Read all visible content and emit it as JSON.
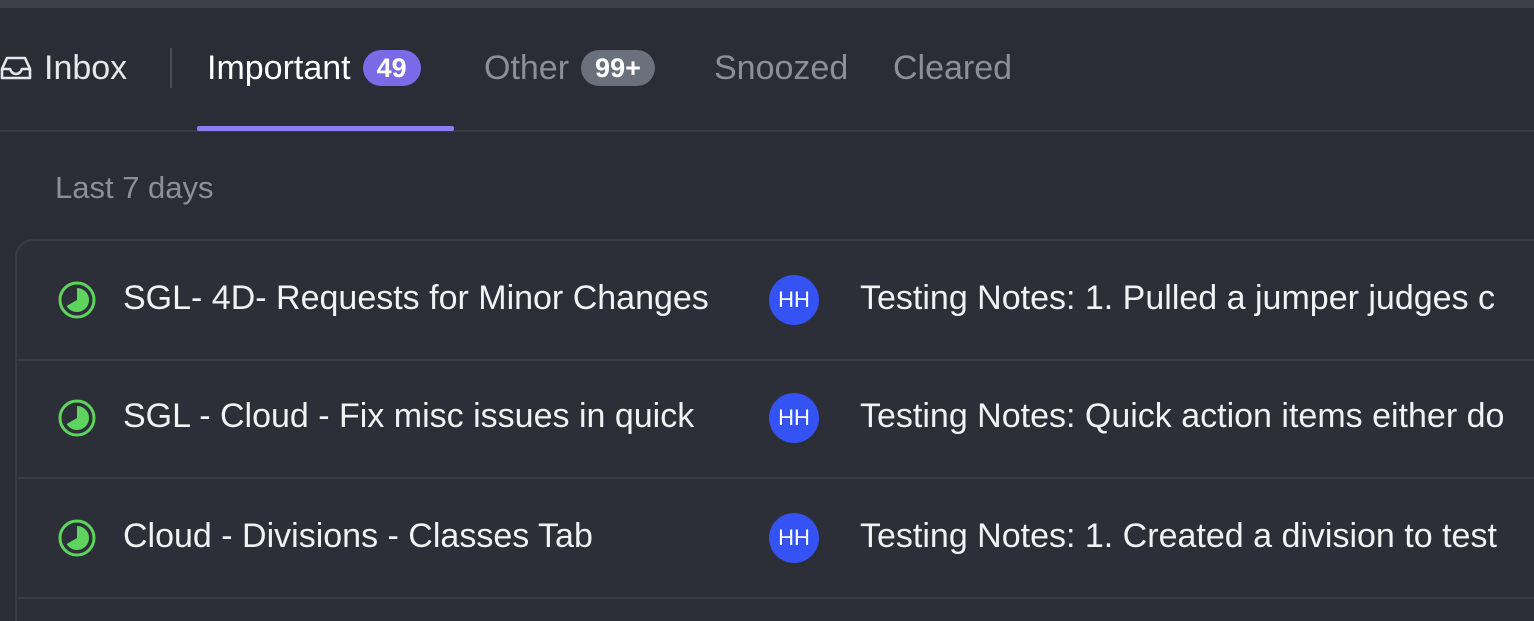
{
  "tabs": {
    "inbox": {
      "label": "Inbox",
      "icon": "inbox-icon"
    },
    "important": {
      "label": "Important",
      "badge": "49"
    },
    "other": {
      "label": "Other",
      "badge": "99+"
    },
    "snoozed": {
      "label": "Snoozed"
    },
    "cleared": {
      "label": "Cleared"
    },
    "active": "important"
  },
  "section": {
    "label": "Last 7 days"
  },
  "items": [
    {
      "title": "SGL- 4D- Requests for Minor Changes",
      "assignee_initials": "HH",
      "notes": "Testing Notes:  1.  Pulled a jumper judges c",
      "status_icon": "in-progress-icon"
    },
    {
      "title": "SGL - Cloud - Fix misc issues in quick",
      "assignee_initials": "HH",
      "notes": "Testing Notes:  Quick action items either do",
      "status_icon": "in-progress-icon"
    },
    {
      "title": "Cloud - Divisions - Classes Tab",
      "assignee_initials": "HH",
      "notes": "Testing Notes:  1.  Created a division to test",
      "status_icon": "in-progress-icon"
    }
  ],
  "colors": {
    "background": "#2a2d35",
    "accent": "#8b7ff0",
    "badge_purple": "#7b6ae8",
    "badge_gray": "#6a707c",
    "avatar": "#3552f4",
    "status_green": "#5ed35e"
  }
}
